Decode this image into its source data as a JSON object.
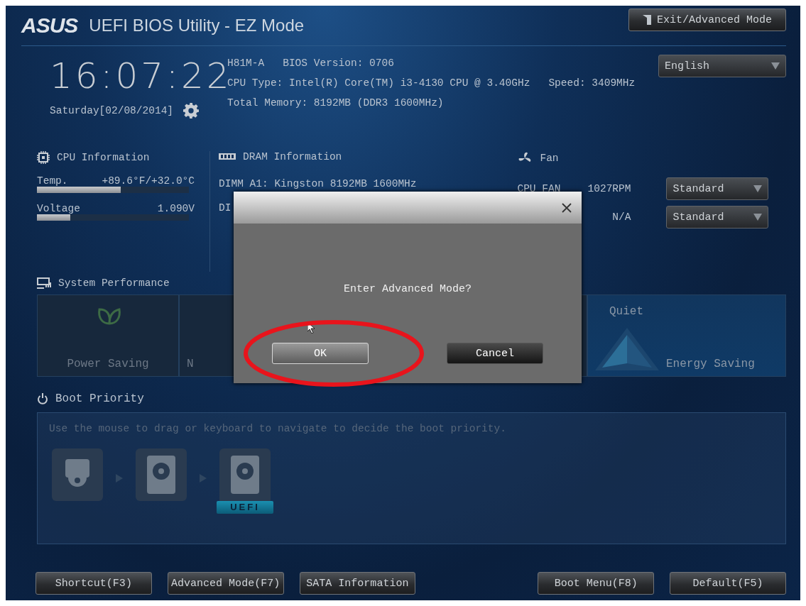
{
  "header": {
    "logo": "ASUS",
    "title": "UEFI BIOS Utility - EZ Mode",
    "exit_button": "Exit/Advanced Mode",
    "language": "English"
  },
  "clock": {
    "time": "16:07:22",
    "date": "Saturday[02/08/2014]"
  },
  "system_info": {
    "board": "H81M-A",
    "bios": "BIOS Version: 0706",
    "cpu": "CPU Type: Intel(R) Core(TM) i3-4130 CPU @ 3.40GHz",
    "speed": "Speed: 3409MHz",
    "memory": "Total Memory: 8192MB (DDR3 1600MHz)"
  },
  "cpu": {
    "title": "CPU Information",
    "rows": [
      {
        "label": "Temp.",
        "value": "+89.6°F/+32.0°C",
        "level": 0.55
      },
      {
        "label": "Voltage",
        "value": "1.090V",
        "level": 0.22
      }
    ]
  },
  "dram": {
    "title": "DRAM Information",
    "lines": [
      "DIMM A1: Kingston 8192MB 1600MHz",
      "DI"
    ]
  },
  "fan": {
    "title": "Fan",
    "rows": [
      {
        "name": "CPU FAN",
        "value": "1027RPM",
        "mode": "Standard"
      },
      {
        "value": "N/A",
        "mode": "Standard"
      }
    ]
  },
  "performance": {
    "title": "System Performance",
    "modes": [
      {
        "kind": "leaf",
        "label": "Power Saving"
      },
      {
        "kind": "plain",
        "label": "N"
      },
      {
        "kind": "radar",
        "top": "Quiet",
        "bottom": "Energy Saving"
      }
    ]
  },
  "boot": {
    "title": "Boot Priority",
    "hint": "Use the mouse to drag or keyboard to navigate to decide the boot priority.",
    "devices": [
      {
        "kind": "optical"
      },
      {
        "kind": "disk"
      },
      {
        "kind": "disk",
        "badge": "UEFI"
      }
    ]
  },
  "footer": {
    "left": [
      "Shortcut(F3)",
      "Advanced Mode(F7)",
      "SATA Information"
    ],
    "right": [
      "Boot Menu(F8)",
      "Default(F5)"
    ]
  },
  "dialog": {
    "message": "Enter Advanced Mode?",
    "buttons": [
      {
        "label": "OK",
        "selected": true
      },
      {
        "label": "Cancel",
        "selected": false
      }
    ]
  }
}
